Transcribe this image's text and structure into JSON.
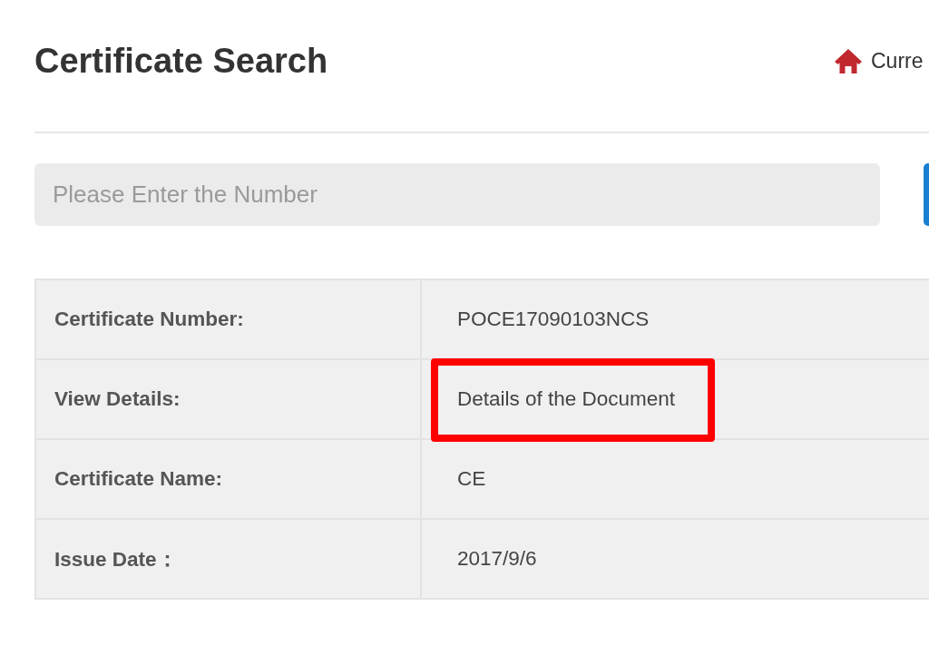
{
  "header": {
    "title": "Certificate Search",
    "breadcrumb": "Curre"
  },
  "search": {
    "placeholder": "Please Enter the Number"
  },
  "details": [
    {
      "label": "Certificate Number:",
      "value": "POCE17090103NCS",
      "highlighted": false
    },
    {
      "label": "View Details:",
      "value": "Details of the Document",
      "highlighted": true
    },
    {
      "label": "Certificate Name:",
      "value": "CE",
      "highlighted": false
    },
    {
      "label": "Issue Date：",
      "value": "2017/9/6",
      "highlighted": false
    }
  ]
}
